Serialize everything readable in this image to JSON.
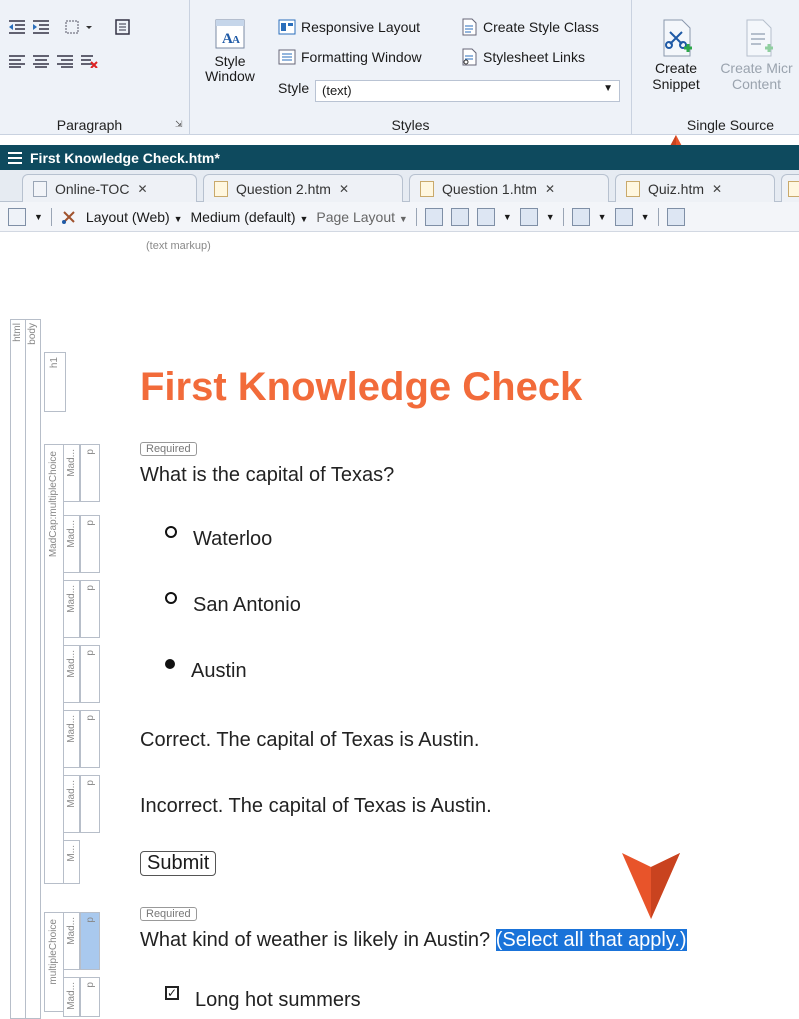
{
  "ribbon": {
    "paragraph_label": "Paragraph",
    "styles_label": "Styles",
    "single_source_label": "Single Source",
    "style_window_label_1": "Style",
    "style_window_label_2": "Window",
    "responsive_layout": "Responsive Layout",
    "formatting_window": "Formatting Window",
    "create_style_class": "Create Style Class",
    "stylesheet_links": "Stylesheet Links",
    "style_prefix": "Style",
    "style_value": "(text)",
    "create_snippet_1": "Create",
    "create_snippet_2": "Snippet",
    "create_micro_1": "Create Micr",
    "create_micro_2": "Content"
  },
  "window": {
    "title": "First Knowledge Check.htm*"
  },
  "tabs": [
    {
      "label": "Online-TOC"
    },
    {
      "label": "Question 2.htm"
    },
    {
      "label": "Question 1.htm"
    },
    {
      "label": "Quiz.htm"
    }
  ],
  "editor_toolbar": {
    "layout": "Layout (Web)",
    "medium": "Medium (default)",
    "page_layout": "Page Layout"
  },
  "content": {
    "markup_note": "(text markup)",
    "heading": "First Knowledge Check",
    "required_1": "Required",
    "question_1": "What is the capital of Texas?",
    "options": [
      "Waterloo",
      "San Antonio",
      "Austin"
    ],
    "selected_option": "Austin",
    "correct_feedback": "Correct. The capital of Texas is Austin.",
    "incorrect_feedback": "Incorrect. The capital of Texas is Austin.",
    "submit": "Submit",
    "required_2": "Required",
    "question_2_prefix": "What kind of weather is likely in Austin?",
    "question_2_selected": "(Select all that apply.)",
    "checkbox_option_1": "Long hot summers"
  },
  "structure_bar": {
    "html": "html",
    "body": "body",
    "h1": "h1",
    "multiple_choice": "MadCap:multipleChoice",
    "multiple_choice_2": "multipleChoice",
    "mad": "Mad...",
    "p": "p",
    "m": "M..."
  },
  "colors": {
    "heading": "#f26b3a",
    "callout_arrow": "#e8542a",
    "selection": "#1a73d9",
    "title_bar": "#0e4a5e"
  }
}
